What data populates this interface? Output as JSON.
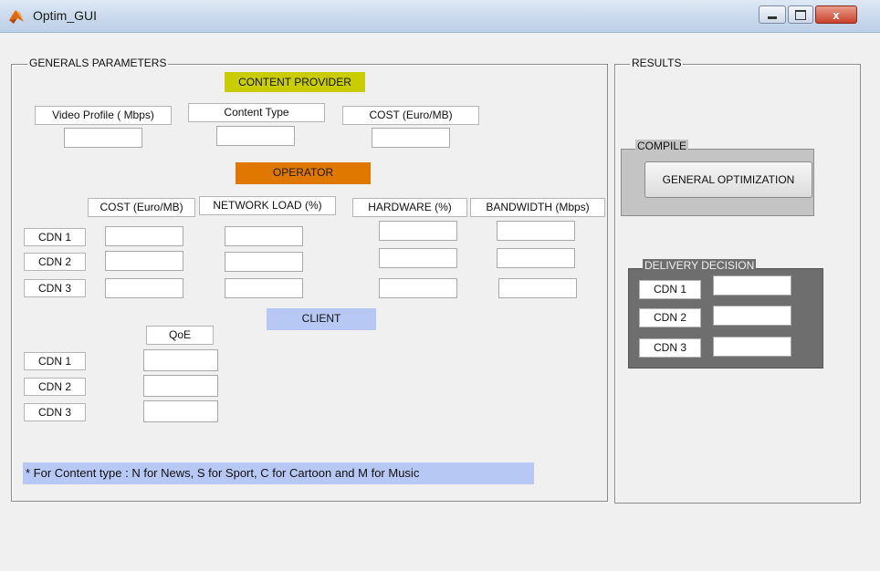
{
  "window": {
    "title": "Optim_GUI",
    "close_glyph": "x"
  },
  "colors": {
    "content_provider": "#c8cc00",
    "operator": "#e07800",
    "client": "#b8c8f4",
    "note": "#b8c8f4"
  },
  "general": {
    "title": "GENERALS PARAMETERS",
    "content_provider": {
      "header": "CONTENT PROVIDER",
      "video_profile": "Video Profile ( Mbps)",
      "content_type": "Content Type",
      "cost": "COST (Euro/MB)"
    },
    "operator": {
      "header": "OPERATOR",
      "columns": [
        "COST (Euro/MB)",
        "NETWORK LOAD (%)",
        "HARDWARE  (%)",
        "BANDWIDTH (Mbps)"
      ],
      "rows": [
        "CDN 1",
        "CDN 2",
        "CDN 3"
      ]
    },
    "client": {
      "header": "CLIENT",
      "qoe": "QoE",
      "rows": [
        "CDN 1",
        "CDN 2",
        "CDN 3"
      ]
    },
    "note": "* For Content type :  N for News, S for Sport, C for Cartoon and M for Music"
  },
  "results": {
    "title": "RESULTS",
    "compile": {
      "title": "COMPILE",
      "button": "GENERAL OPTIMIZATION"
    },
    "delivery": {
      "title": "DELIVERY DECISION",
      "rows": [
        "CDN 1",
        "CDN 2",
        "CDN 3"
      ]
    }
  }
}
